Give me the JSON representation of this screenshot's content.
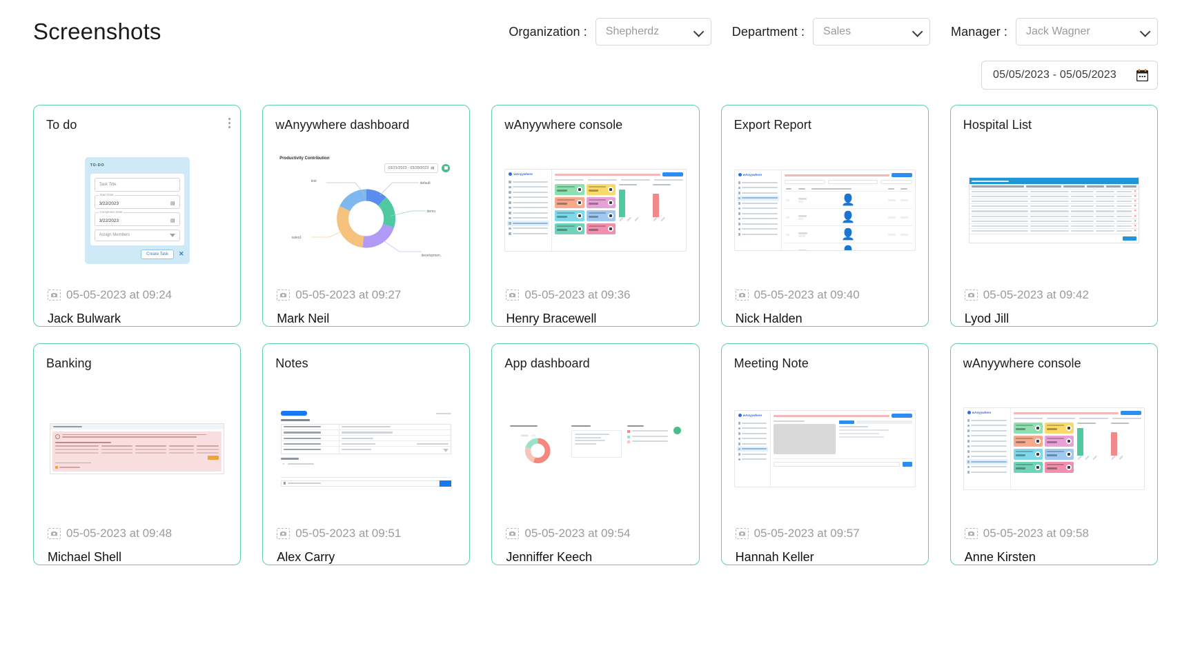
{
  "header": {
    "title": "Screenshots",
    "filters": [
      {
        "label": "Organization :",
        "value": "Shepherdz",
        "name": "organization"
      },
      {
        "label": "Department :",
        "value": "Sales",
        "name": "department"
      },
      {
        "label": "Manager :",
        "value": "Jack Wagner",
        "name": "manager"
      }
    ],
    "date_range": "05/05/2023 - 05/05/2023"
  },
  "cards": [
    {
      "title": "To do",
      "timestamp": "05-05-2023 at 09:24",
      "user": "Jack Bulwark",
      "mock": "todo",
      "mock_text": {
        "heading": "TO-DO",
        "task_title_placeholder": "Task Title",
        "start_date_label": "Start Date",
        "start_date_value": "3/22/2023",
        "completion_date_label": "Completion Date",
        "completion_date_value": "3/22/2023",
        "assign_placeholder": "Assign Members",
        "create_button": "Create Task"
      }
    },
    {
      "title": "wAnyywhere dashboard",
      "timestamp": "05-05-2023 at 09:27",
      "user": "Mark Neil",
      "mock": "donut",
      "mock_text": {
        "chart_title": "Productivity Contribution",
        "date_range": "03/21/2023 - 03/28/2023"
      }
    },
    {
      "title": "wAnyywhere console",
      "timestamp": "05-05-2023 at 09:36",
      "user": "Henry Bracewell",
      "mock": "console"
    },
    {
      "title": "Export Report",
      "timestamp": "05-05-2023 at 09:40",
      "user": "Nick Halden",
      "mock": "report"
    },
    {
      "title": "Hospital List",
      "timestamp": "05-05-2023 at 09:42",
      "user": "Lyod Jill",
      "mock": "hospital"
    },
    {
      "title": "Banking",
      "timestamp": "05-05-2023 at 09:48",
      "user": "Michael Shell",
      "mock": "banking"
    },
    {
      "title": "Notes",
      "timestamp": "05-05-2023 at 09:51",
      "user": "Alex Carry",
      "mock": "notes"
    },
    {
      "title": "App dashboard",
      "timestamp": "05-05-2023 at 09:54",
      "user": "Jenniffer Keech",
      "mock": "appdash"
    },
    {
      "title": "Meeting Note",
      "timestamp": "05-05-2023 at 09:57",
      "user": "Hannah Keller",
      "mock": "meeting"
    },
    {
      "title": "wAnyywhere console",
      "timestamp": "05-05-2023 at 09:58",
      "user": "Anne Kirsten",
      "mock": "console2"
    }
  ],
  "chart_data": {
    "type": "pie",
    "title": "Productivity Contribution",
    "subtitle": "03/21/2023 - 03/28/2023",
    "categories": [
      "default",
      "demo",
      "development",
      "sales1",
      "test"
    ],
    "values": [
      12,
      18,
      22,
      30,
      18
    ],
    "colors": [
      "#5b8def",
      "#4ec9a0",
      "#b19af5",
      "#f5c27d",
      "#7db9ef"
    ],
    "legend": "callout-labels",
    "xlabel": "",
    "ylabel": ""
  },
  "theme": {
    "card_border": "#5fcfa8",
    "accent_blue": "#2d8cf0",
    "muted_text": "#9b9b9b"
  }
}
